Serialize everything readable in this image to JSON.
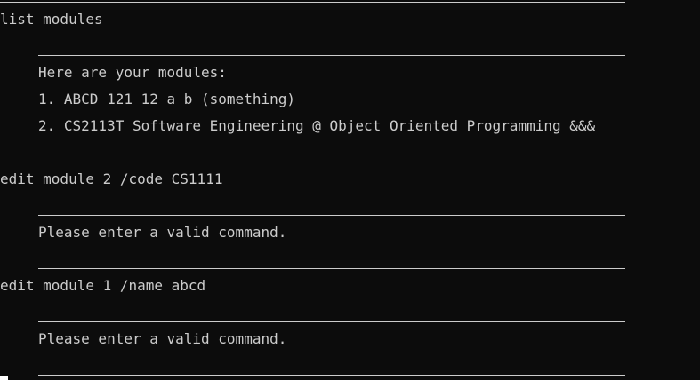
{
  "terminal": {
    "blocks": [
      {
        "type": "command",
        "text": "list modules"
      },
      {
        "type": "output",
        "lines": [
          "Here are your modules:",
          "1. ABCD 121 12 a b (something)",
          "2. CS2113T Software Engineering @ Object Oriented Programming &&&"
        ]
      },
      {
        "type": "command",
        "text": "edit module 2 /code CS1111"
      },
      {
        "type": "output",
        "lines": [
          "Please enter a valid command."
        ]
      },
      {
        "type": "command",
        "text": "edit module 1 /name abcd"
      },
      {
        "type": "output",
        "lines": [
          "Please enter a valid command."
        ]
      }
    ]
  }
}
